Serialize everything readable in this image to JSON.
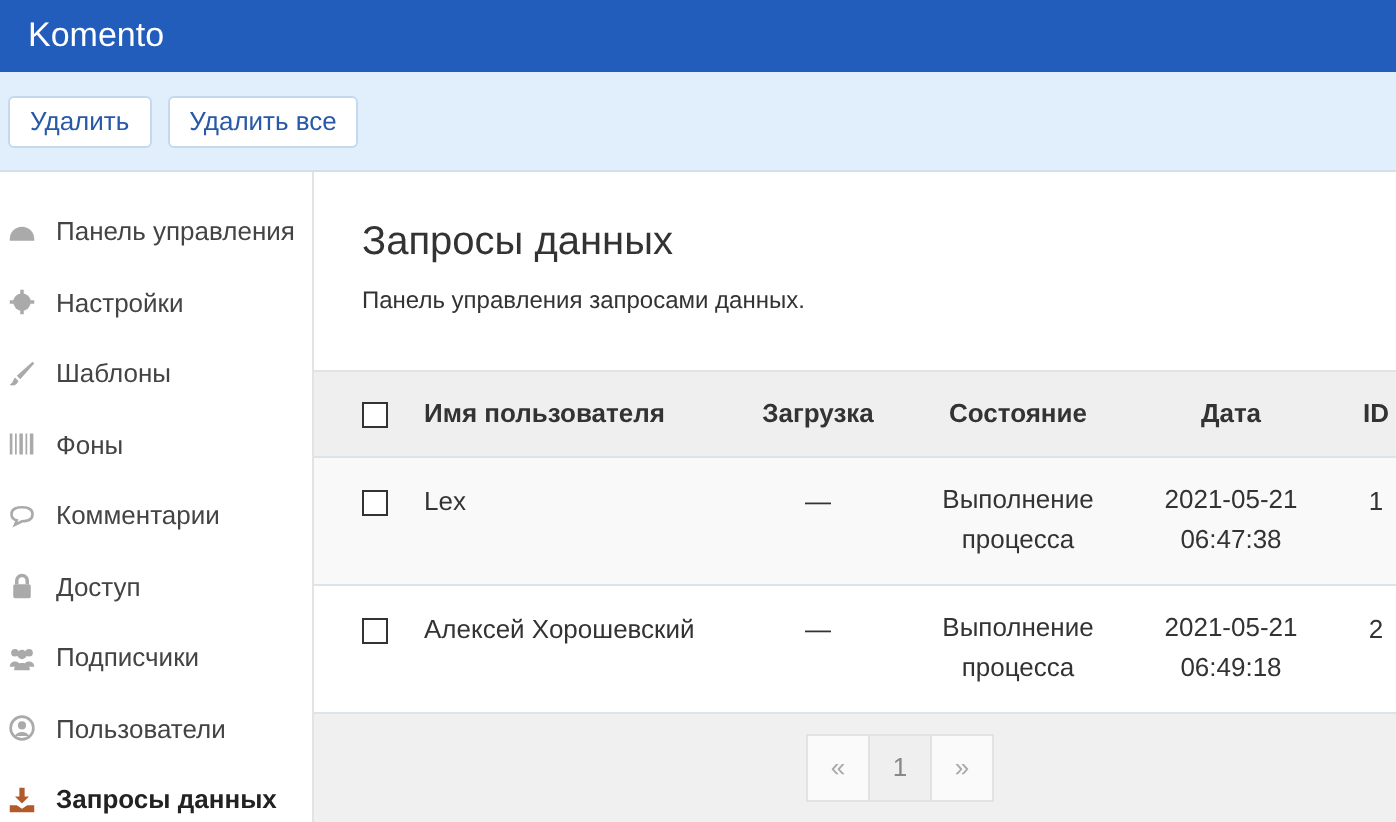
{
  "header": {
    "title": "Komento"
  },
  "toolbar": {
    "buttons": [
      "Удалить",
      "Удалить все"
    ]
  },
  "sidebar": {
    "items": [
      {
        "label": "Панель управления",
        "selected": false
      },
      {
        "label": "Настройки",
        "selected": false
      },
      {
        "label": "Шаблоны",
        "selected": false
      },
      {
        "label": "Фоны",
        "selected": false
      },
      {
        "label": "Комментарии",
        "selected": false
      },
      {
        "label": "Доступ",
        "selected": false
      },
      {
        "label": "Подписчики",
        "selected": false
      },
      {
        "label": "Пользователи",
        "selected": false
      },
      {
        "label": "Запросы данных",
        "selected": true
      }
    ]
  },
  "page": {
    "title": "Запросы данных",
    "subtitle": "Панель управления запросами данных."
  },
  "table": {
    "select_all_checked": false,
    "columns": [
      "Имя пользователя",
      "Загрузка",
      "Состояние",
      "Дата",
      "ID"
    ],
    "rows": [
      {
        "checked": false,
        "username": "Lex",
        "download": "—",
        "state": "Выполнение процесса",
        "date": "2021-05-21 06:47:38",
        "id": "1"
      },
      {
        "checked": false,
        "username": "Алексей Хорошевский",
        "download": "—",
        "state": "Выполнение процесса",
        "date": "2021-05-21 06:49:18",
        "id": "2"
      }
    ]
  },
  "pagination": {
    "prev": {
      "label": "«",
      "disabled": true
    },
    "pages": [
      {
        "label": "1",
        "selected": true
      }
    ],
    "next": {
      "label": "»",
      "disabled": true
    }
  }
}
